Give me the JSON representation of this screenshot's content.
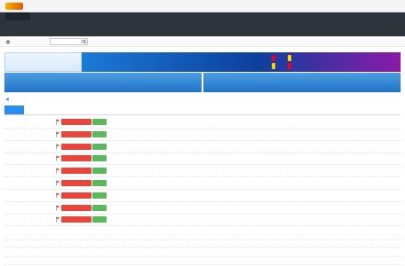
{
  "colors": {
    "nav_bg": "#2d343c",
    "accent": "#2d8cf0",
    "tag_red": "#e8463b",
    "tag_green": "#5cb85c",
    "hot_red": "#c0392b"
  },
  "icons": {
    "home": "home-icon",
    "notice": "speaker-icon",
    "flag": "flag-icon",
    "search": "search-icon"
  },
  "topbar": {
    "links": [
      "",
      "",
      ""
    ]
  },
  "nav": {
    "active_index": 0,
    "items": [
      "",
      "",
      "",
      "",
      "",
      "",
      "",
      "",
      "",
      "",
      "",
      "",
      "",
      "",
      "",
      "",
      "",
      "",
      "",
      "",
      "",
      "",
      "",
      "",
      "",
      "",
      "",
      "",
      "",
      "",
      "",
      "",
      "",
      "",
      "",
      "",
      "",
      "",
      "",
      "",
      "",
      "",
      "",
      "",
      ""
    ]
  },
  "subbar": {
    "breadcrumb": "",
    "search_placeholder": ""
  },
  "banners": {
    "brand": "",
    "brand_url": "",
    "headline": "",
    "chip_1": "",
    "chip_2": "",
    "chip_3": "",
    "chip_4": "",
    "slogan": "",
    "idle_1": "",
    "idle_2": ""
  },
  "notice": {
    "link": ""
  },
  "tabs": {
    "active": "",
    "other": ""
  },
  "threads": [
    {
      "tag": "",
      "badge": "",
      "badge2": "",
      "title": "",
      "by": "",
      "date": "",
      "stats": "",
      "stats2": ""
    },
    {
      "tag": "",
      "badge": "",
      "badge2": "",
      "title": "",
      "by": "",
      "date": "",
      "stats": "",
      "stats2": ""
    },
    {
      "tag": "",
      "badge": "",
      "badge2": "",
      "title": "",
      "by": "",
      "date": "",
      "stats": "",
      "stats2": ""
    },
    {
      "tag": "",
      "badge": "",
      "badge2": "",
      "title": "",
      "by": "",
      "date": "",
      "stats": "",
      "stats2": ""
    },
    {
      "tag": "",
      "badge": "",
      "badge2": "",
      "title": "",
      "by": "",
      "date": "",
      "stats": "",
      "stats2": ""
    },
    {
      "tag": "",
      "badge": "",
      "badge2": "",
      "title": "",
      "by": "",
      "date": "",
      "stats": "",
      "stats2": ""
    },
    {
      "tag": "",
      "badge": "",
      "badge2": "",
      "title": "",
      "by": "",
      "date": "",
      "stats": "",
      "stats2": ""
    },
    {
      "tag": "",
      "badge": "",
      "badge2": "",
      "title": "",
      "by": "",
      "date": "",
      "stats": "",
      "stats2": ""
    },
    {
      "tag": "",
      "badge": "",
      "badge2": "",
      "title": "",
      "by": "",
      "date": "",
      "stats": "",
      "stats2": ""
    }
  ],
  "releases": [
    {
      "cat": "",
      "year": "",
      "res": "",
      "code": "",
      "name": "",
      "date": "",
      "size": ""
    },
    {
      "cat": "",
      "year": "",
      "res": "",
      "code": "",
      "name": "",
      "date": "",
      "size": ""
    },
    {
      "cat": "",
      "year": "",
      "res": "",
      "code": "",
      "name": "",
      "date": "",
      "size": ""
    },
    {
      "cat": "",
      "year": "",
      "res": "",
      "code": "",
      "name": "",
      "date": "",
      "size": ""
    }
  ]
}
